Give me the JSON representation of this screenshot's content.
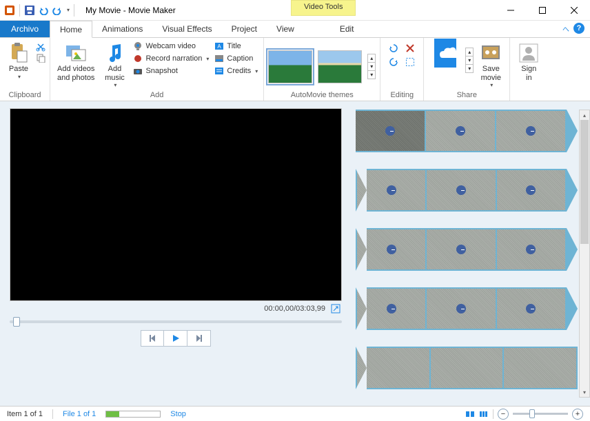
{
  "title": "My Movie - Movie Maker",
  "contextual_tab": "Video Tools",
  "tabs": {
    "file": "Archivo",
    "home": "Home",
    "animations": "Animations",
    "visual_effects": "Visual Effects",
    "project": "Project",
    "view": "View",
    "edit": "Edit"
  },
  "ribbon": {
    "clipboard": {
      "paste": "Paste",
      "label": "Clipboard"
    },
    "add": {
      "add_videos": "Add videos\nand photos",
      "add_music": "Add\nmusic",
      "webcam": "Webcam video",
      "record": "Record narration",
      "snapshot": "Snapshot",
      "title": "Title",
      "caption": "Caption",
      "credits": "Credits",
      "label": "Add"
    },
    "themes": {
      "label": "AutoMovie themes"
    },
    "editing": {
      "label": "Editing"
    },
    "share": {
      "save_movie": "Save\nmovie",
      "sign_in": "Sign\nin",
      "label": "Share"
    }
  },
  "preview": {
    "time": "00:00,00/03:03,99"
  },
  "status": {
    "item": "Item 1 of 1",
    "file": "File 1 of 1",
    "action": "Stop"
  }
}
